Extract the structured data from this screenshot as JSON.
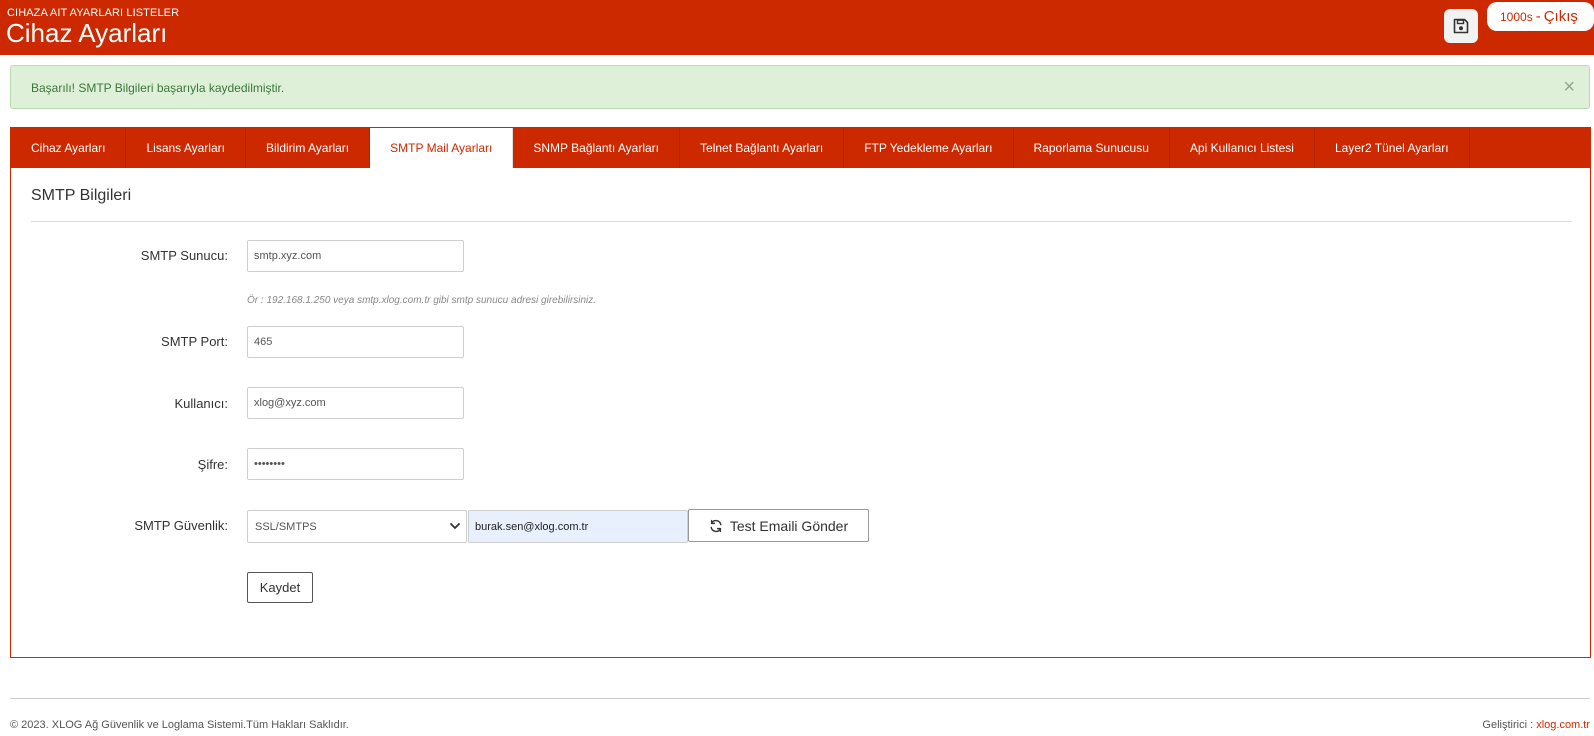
{
  "header": {
    "subtitle": "CIHAZA AIT AYARLARI LISTELER",
    "title": "Cihaz Ayarları",
    "user_label": "1000s",
    "separator": "-",
    "logout_label": "Çıkış"
  },
  "alert": {
    "message": "Başarılı! SMTP Bilgileri başarıyla kaydedilmiştir.",
    "close_symbol": "×"
  },
  "tabs": [
    {
      "label": "Cihaz Ayarları",
      "active": false
    },
    {
      "label": "Lisans Ayarları",
      "active": false
    },
    {
      "label": "Bildirim Ayarları",
      "active": false
    },
    {
      "label": "SMTP Mail Ayarları",
      "active": true
    },
    {
      "label": "SNMP Bağlantı Ayarları",
      "active": false
    },
    {
      "label": "Telnet Bağlantı Ayarları",
      "active": false
    },
    {
      "label": "FTP Yedekleme Ayarları",
      "active": false
    },
    {
      "label": "Raporlama Sunucusu",
      "active": false
    },
    {
      "label": "Api Kullanıcı Listesi",
      "active": false
    },
    {
      "label": "Layer2 Tünel Ayarları",
      "active": false
    }
  ],
  "form": {
    "section_title": "SMTP Bilgileri",
    "server": {
      "label": "SMTP Sunucu:",
      "value": "smtp.xyz.com"
    },
    "server_hint": "Ör : 192.168.1.250 veya smtp.xlog.com.tr gibi smtp sunucu adresi girebilirsiniz.",
    "port": {
      "label": "SMTP Port:",
      "value": "465"
    },
    "user": {
      "label": "Kullanıcı:",
      "value": "xlog@xyz.com"
    },
    "password": {
      "label": "Şifre:",
      "value": "password"
    },
    "security": {
      "label": "SMTP Güvenlik:",
      "value": "SSL/SMTPS"
    },
    "test_email": "burak.sen@xlog.com.tr",
    "test_button": "Test Emaili Gönder",
    "save_button": "Kaydet"
  },
  "footer": {
    "copyright": "© 2023. XLOG Ağ Güvenlik ve Loglama Sistemi.Tüm Hakları Saklıdır.",
    "developer_label": "Geliştirici :",
    "developer_link": "xlog.com.tr"
  },
  "colors": {
    "brand": "#cc2900",
    "success_bg": "#dff0d8",
    "success_text": "#3c763d"
  }
}
